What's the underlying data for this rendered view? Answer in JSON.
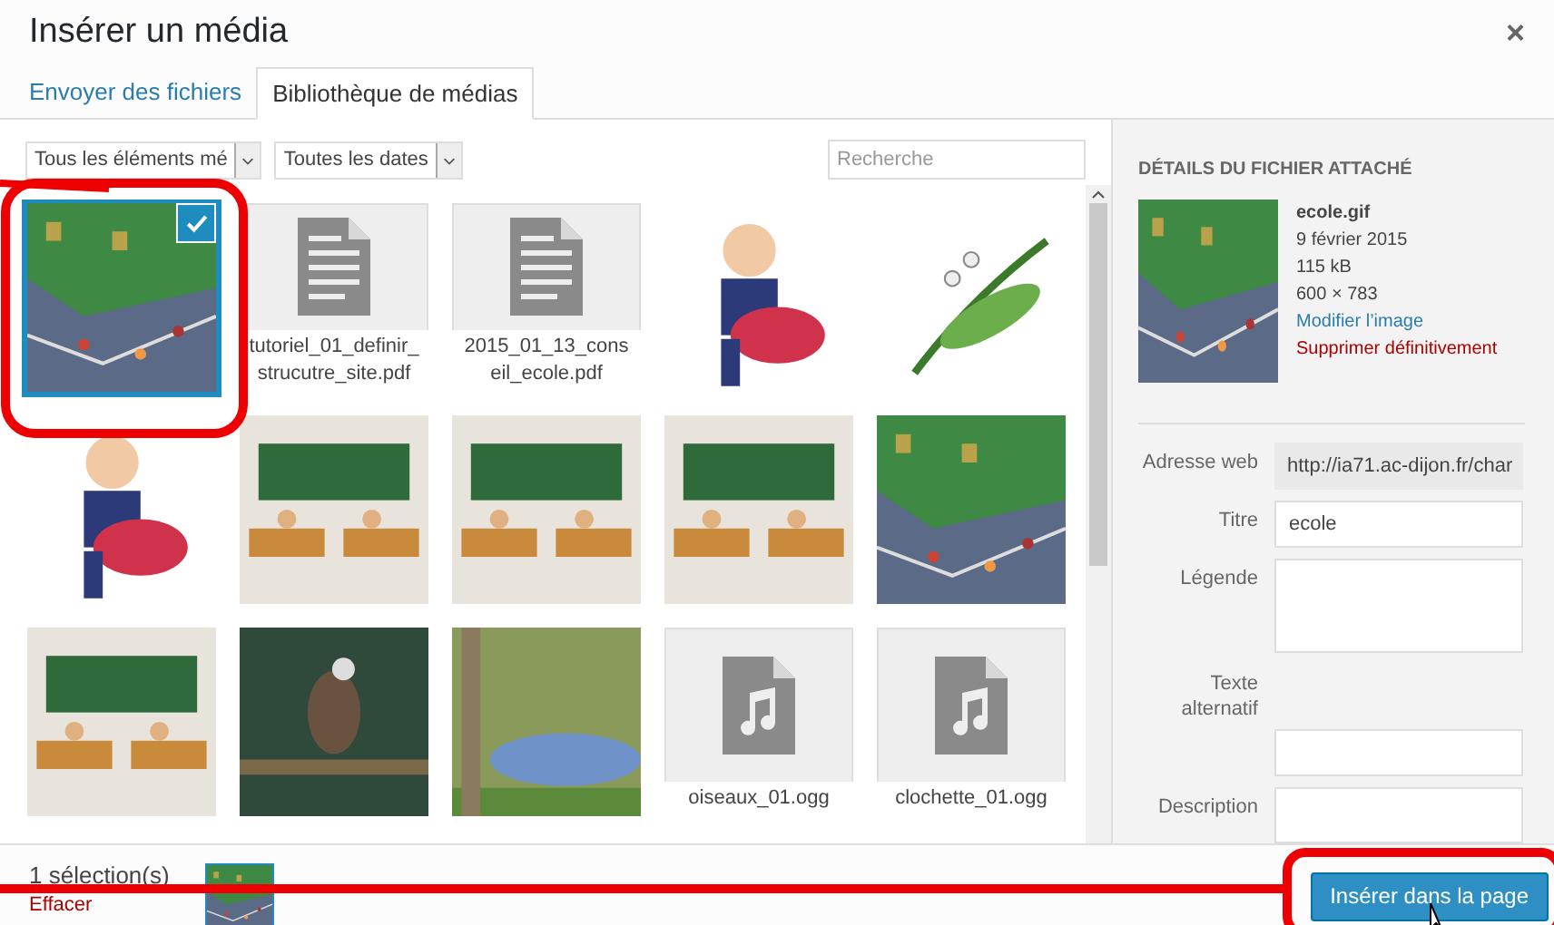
{
  "window": {
    "title": "Insérer un média",
    "close": "×"
  },
  "tabs": [
    {
      "label": "Envoyer des fichiers",
      "selected": false
    },
    {
      "label": "Bibliothèque de médias",
      "selected": true
    }
  ],
  "filters": [
    {
      "value": "Tous les éléments mé"
    },
    {
      "value": "Toutes les dates"
    }
  ],
  "search": {
    "placeholder": "Recherche"
  },
  "grid": [
    {
      "kind": "picture",
      "selected": true
    },
    {
      "kind": "document",
      "filename": "tutoriel_01_definir_strucutre_site.pdf",
      "selected": false
    },
    {
      "kind": "document",
      "filename": "2015_01_13_conseil_ecole.pdf",
      "selected": false
    },
    {
      "kind": "picture",
      "selected": false
    },
    {
      "kind": "picture",
      "selected": false
    },
    {
      "kind": "picture",
      "selected": false
    },
    {
      "kind": "picture",
      "selected": false
    },
    {
      "kind": "picture",
      "selected": false
    },
    {
      "kind": "picture",
      "selected": false
    },
    {
      "kind": "picture",
      "selected": false
    },
    {
      "kind": "picture",
      "selected": false
    },
    {
      "kind": "picture",
      "selected": false
    },
    {
      "kind": "picture",
      "selected": false
    },
    {
      "kind": "audio",
      "filename": "oiseaux_01.ogg",
      "selected": false
    },
    {
      "kind": "audio",
      "filename": "clochette_01.ogg",
      "selected": false
    }
  ],
  "details": {
    "heading": "DÉTAILS DU FICHIER ATTACHÉ",
    "filename": "ecole.gif",
    "date": "9 février 2015",
    "size": "115 kB",
    "dimensions": "600 × 783",
    "edit_link": "Modifier l’image",
    "delete_link": "Supprimer définitivement",
    "fields": [
      {
        "label": "Adresse web",
        "value": "http://ia71.ac-dijon.fr/char",
        "kind": "readonly"
      },
      {
        "label": "Titre",
        "value": "ecole",
        "kind": "input"
      },
      {
        "label": "Légende",
        "kind": "textarea"
      },
      {
        "label": "Texte alternatif",
        "kind": "input-below"
      },
      {
        "label": "Description",
        "kind": "textarea"
      }
    ]
  },
  "selection": {
    "count": "1 sélection(s)",
    "clear": "Effacer"
  },
  "insert_button": "Insérer dans la page"
}
